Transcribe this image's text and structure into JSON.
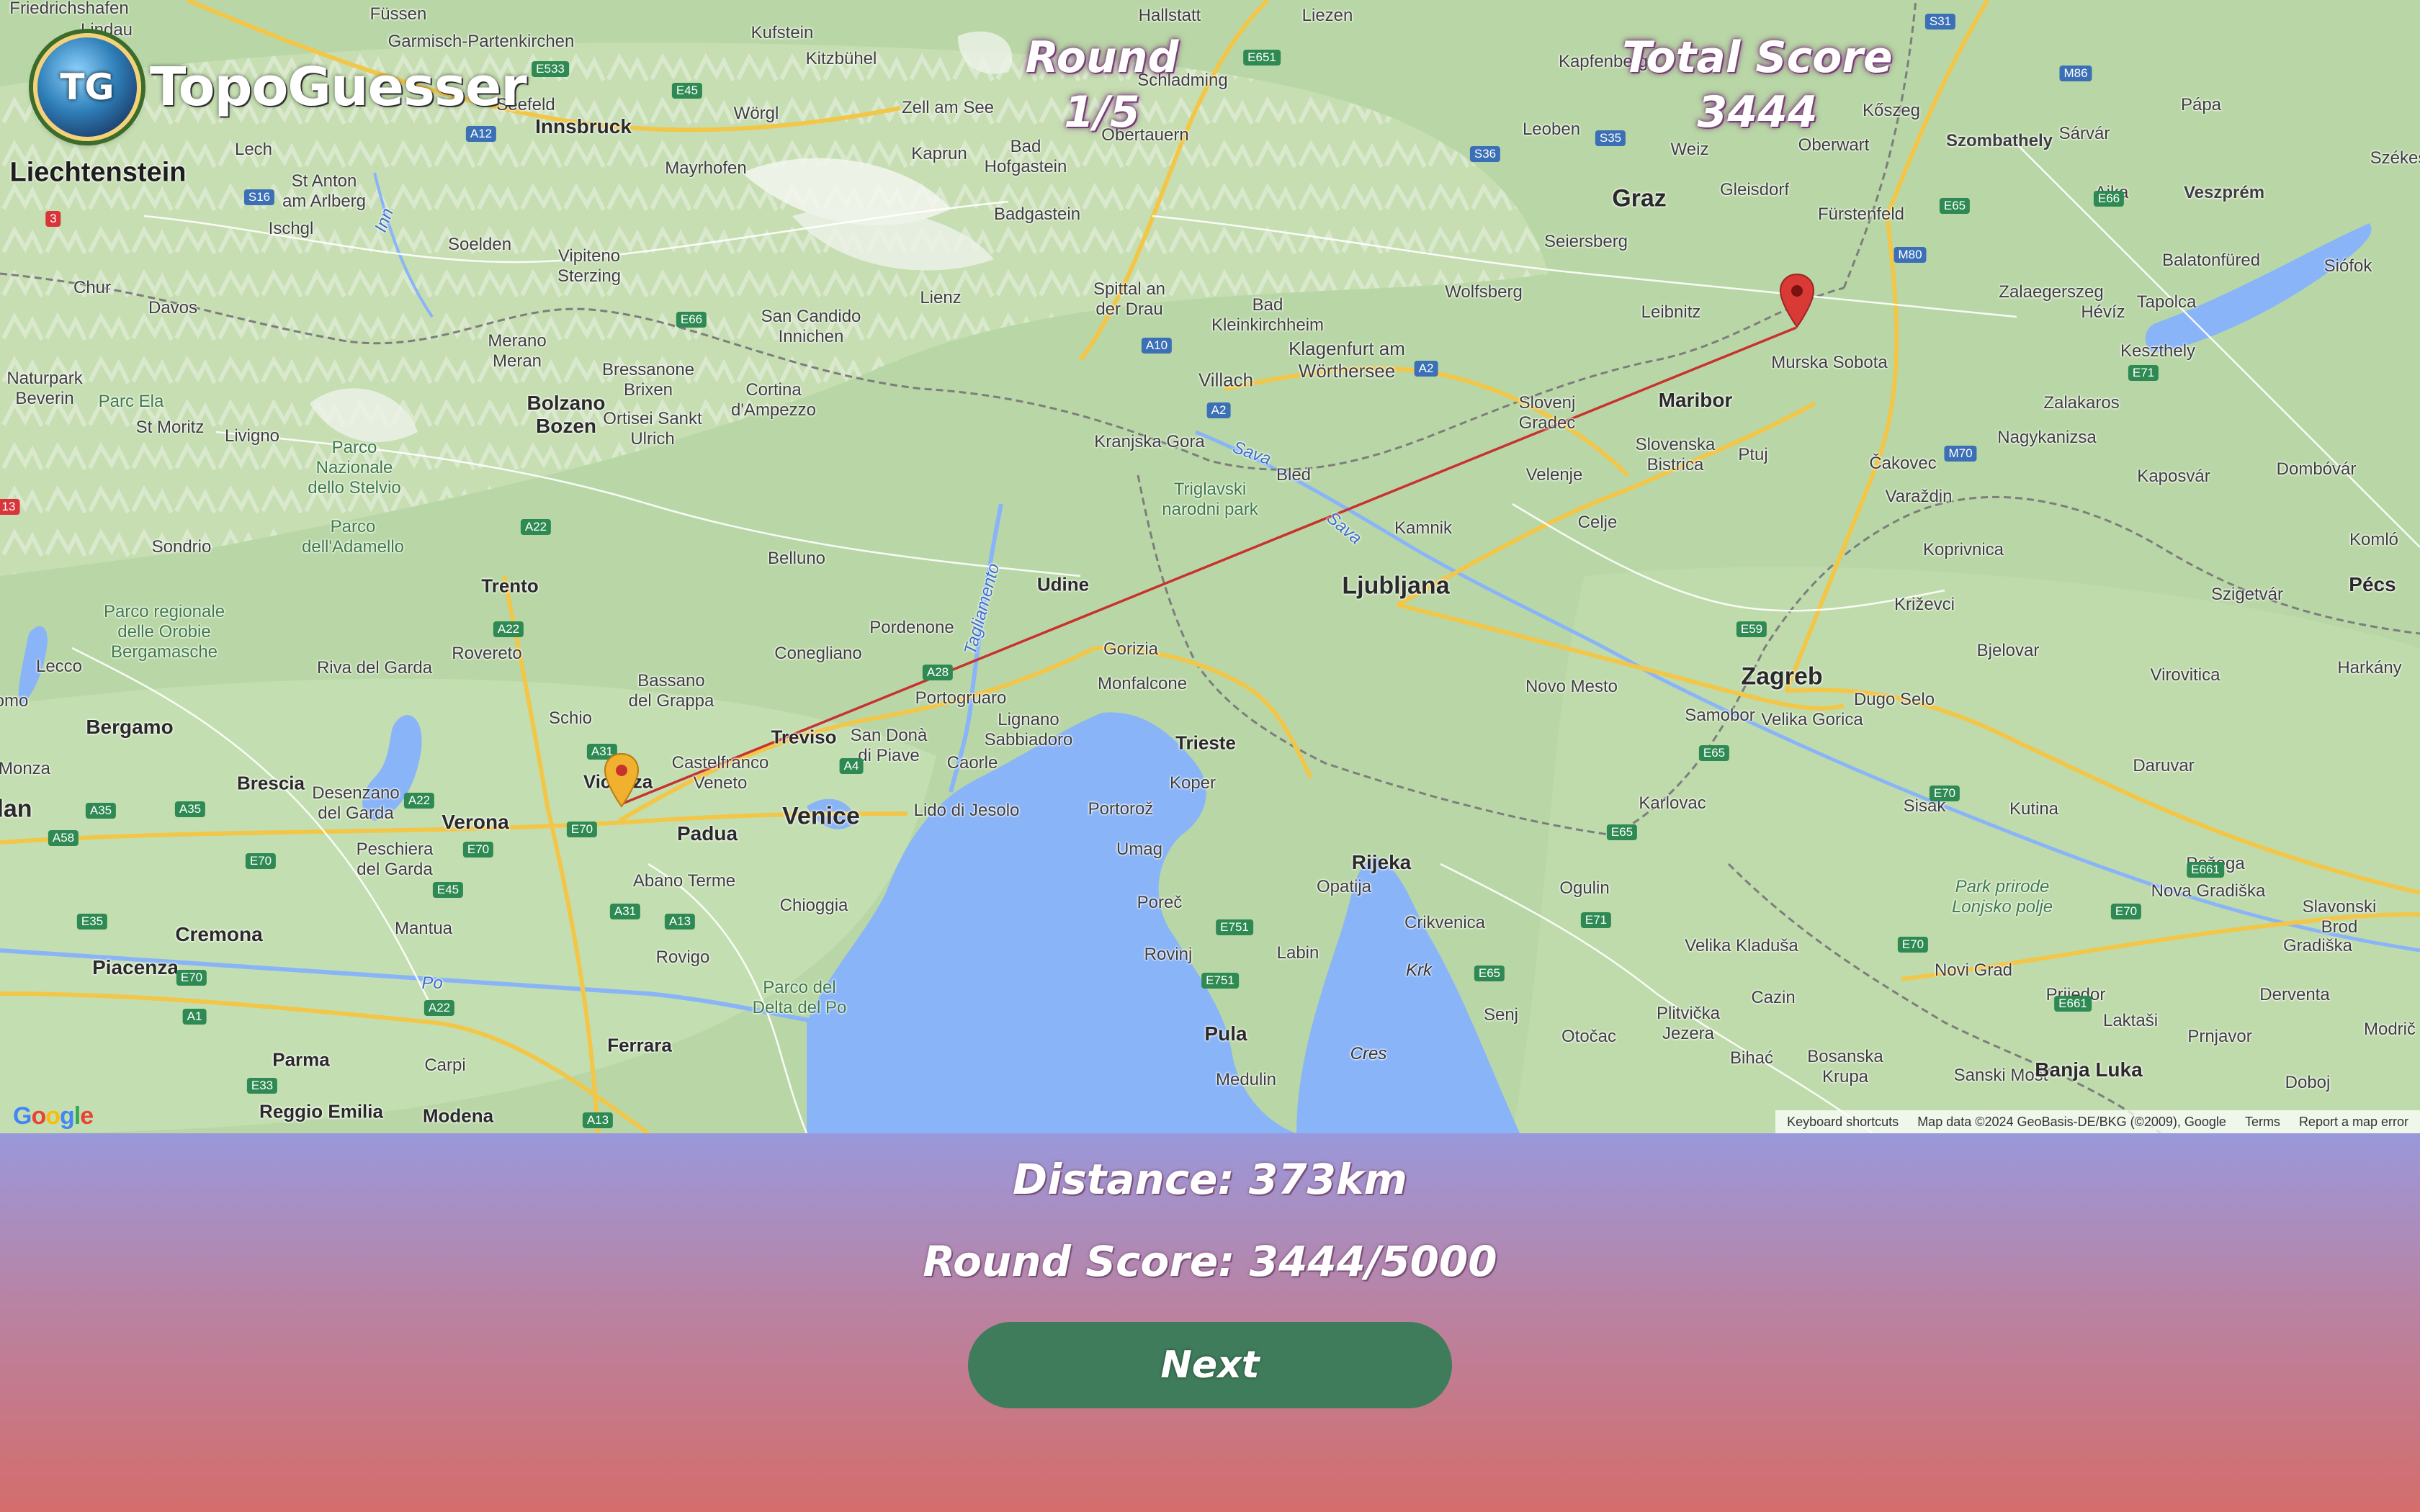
{
  "app": {
    "name": "TopoGuesser",
    "logo_initials": "TG"
  },
  "hud": {
    "round_label": "Round",
    "round_value": "1/5",
    "total_score_label": "Total Score",
    "total_score_value": "3444"
  },
  "result": {
    "distance_text": "Distance: 373km",
    "round_score_text": "Round Score: 3444/5000",
    "next_label": "Next"
  },
  "map": {
    "google_logo": "Google",
    "footer": {
      "shortcuts": "Keyboard shortcuts",
      "map_data": "Map data ©2024 GeoBasis-DE/BKG (©2009), Google",
      "terms": "Terms",
      "report": "Report a map error"
    },
    "places": {
      "friedrichshafen": "Friedrichshafen",
      "lindau": "Lindau",
      "fussen": "Füssen",
      "garmisch": "Garmisch-Partenkirchen",
      "kufstein": "Kufstein",
      "hallstatt": "Hallstatt",
      "liezen": "Liezen",
      "kapfenberg": "Kapfenberg",
      "seefeld": "Seefeld",
      "innsbruck": "Innsbruck",
      "worgl": "Wörgl",
      "kitzbuhel": "Kitzbühel",
      "schladming": "Schladming",
      "leoben": "Leoben",
      "koszeg": "Kőszeg",
      "liechtenstein": "Liechtenstein",
      "zellamsee": "Zell am See",
      "kaprun": "Kaprun",
      "badhofgastein": "Bad Hofgastein",
      "obertauern": "Obertauern",
      "weiz": "Weiz",
      "oberwart": "Oberwart",
      "szombathely": "Szombathely",
      "sarvar": "Sárvár",
      "papa": "Pápa",
      "szekes": "Székes",
      "lech": "Lech",
      "stanton": "St Anton am Arlberg",
      "mayrhofen": "Mayrhofen",
      "badgastein": "Badgastein",
      "graz": "Graz",
      "gleisdorf": "Gleisdorf",
      "furstenfeld": "Fürstenfeld",
      "ajka": "Ajka",
      "veszprem": "Veszprém",
      "ischgl": "Ischgl",
      "soelden": "Soelden",
      "vipiteno": "Vipiteno Sterzing",
      "seiersberg": "Seiersberg",
      "chur": "Chur",
      "davos": "Davos",
      "lienz": "Lienz",
      "spittal": "Spittal an der Drau",
      "badklein": "Bad Kleinkirchheim",
      "wolfsberg": "Wolfsberg",
      "leibnitz": "Leibnitz",
      "zalaegerszeg": "Zalaegerszeg",
      "balatonfured": "Balatonfüred",
      "siofok": "Siófok",
      "merano": "Merano Meran",
      "sancandido": "San Candido Innichen",
      "heviz": "Hévíz",
      "tapolca": "Tapolca",
      "keszthely": "Keszthely",
      "villach": "Villach",
      "klagenfurt": "Klagenfurt am Wörthersee",
      "murska": "Murska Sobota",
      "naturpark": "Naturpark Beverin",
      "parcela": "Parc Ela",
      "bressanone": "Bressanone Brixen",
      "cortina": "Cortina d'Ampezzo",
      "maribor": "Maribor",
      "slovenjgradec": "Slovenj Gradec",
      "zalakaros": "Zalakaros",
      "stmoritz": "St Moritz",
      "livigno": "Livigno",
      "bolzano": "Bolzano Bozen",
      "ortisei": "Ortisei Sankt Ulrich",
      "kranjska": "Kranjska Gora",
      "nagykanizsa": "Nagykanizsa",
      "stelvio": "Parco Nazionale dello Stelvio",
      "bled": "Bled",
      "slovenska": "Slovenska Bistrica",
      "ptuj": "Ptuj",
      "cakovec": "Čakovec",
      "kaposvar": "Kaposvár",
      "dombovar": "Dombóvár",
      "triglav": "Triglavski narodni park",
      "velenje": "Velenje",
      "varazdin": "Varaždin",
      "sondrio": "Sondrio",
      "adamello": "Parco dell'Adamello",
      "celje": "Celje",
      "kamnik": "Kamnik",
      "komlo": "Komló",
      "belluno": "Belluno",
      "koprivnica": "Koprivnica",
      "trento": "Trento",
      "udine": "Udine",
      "ljubljana": "Ljubljana",
      "szigetvar": "Szigetvár",
      "pecs": "Pécs",
      "orobie": "Parco regionale delle Orobie Bergamasche",
      "pordenone": "Pordenone",
      "krizevci": "Križevci",
      "rovereto": "Rovereto",
      "rivadelgarda": "Riva del Garda",
      "conegliano": "Conegliano",
      "gorizia": "Gorizia",
      "bjelovar": "Bjelovar",
      "virovitica": "Virovitica",
      "harkany": "Harkány",
      "lecco": "Lecco",
      "bassano": "Bassano del Grappa",
      "monfalcone": "Monfalcone",
      "portogruaro": "Portogruaro",
      "novomesto": "Novo Mesto",
      "zagreb": "Zagreb",
      "dugoselo": "Dugo Selo",
      "samobor": "Samobor",
      "velikagorica": "Velika Gorica",
      "como": "omo",
      "bergamo": "Bergamo",
      "schio": "Schio",
      "treviso": "Treviso",
      "lignano": "Lignano Sabbiadoro",
      "trieste": "Trieste",
      "monza": "Monza",
      "brescia": "Brescia",
      "desenzano": "Desenzano del Garda",
      "castelfranco": "Castelfranco Veneto",
      "sandona": "San Donà di Piave",
      "caorle": "Caorle",
      "koper": "Koper",
      "karlovac": "Karlovac",
      "sisak": "Sisak",
      "kutina": "Kutina",
      "daruvar": "Daruvar",
      "milan": "lan",
      "verona": "Verona",
      "vicenza": "Vicenza",
      "venice": "Venice",
      "lidodijesolo": "Lido di Jesolo",
      "portoroz": "Portorož",
      "peschiera": "Peschiera del Garda",
      "padua": "Padua",
      "umag": "Umag",
      "rijeka": "Rijeka",
      "opatija": "Opatija",
      "ogulin": "Ogulin",
      "pozega": "Požega",
      "abano": "Abano Terme",
      "chioggia": "Chioggia",
      "porec": "Poreč",
      "crikvenica": "Crikvenica",
      "lonjsko": "Park prirode Lonjsko polje",
      "novagradiska": "Nova Gradiška",
      "slavonski": "Slavonski Brod",
      "cremona": "Cremona",
      "mantua": "Mantua",
      "rovigo": "Rovigo",
      "rovinj": "Rovinj",
      "labin": "Labin",
      "krk": "Krk",
      "senj": "Senj",
      "velikakladusa": "Velika Kladuša",
      "gradiska": "Gradiška",
      "piacenza": "Piacenza",
      "po": "Po",
      "parcodelta": "Parco del Delta del Po",
      "cazin": "Cazin",
      "novigrad": "Novi Grad",
      "prijedor": "Prijedor",
      "derventa": "Derventa",
      "pula": "Pula",
      "otocac": "Otočac",
      "laktasi": "Laktaši",
      "prnjavor": "Prnjavor",
      "parma": "Parma",
      "carpi": "Carpi",
      "ferrara": "Ferrara",
      "cres": "Cres",
      "plitvicka": "Plitvička Jezera",
      "bihac": "Bihać",
      "bosanska": "Bosanska Krupa",
      "sanskimost": "Sanski Most",
      "banjaluka": "Banja Luka",
      "doboj": "Doboj",
      "reggio": "Reggio Emilia",
      "modena": "Modena",
      "medulin": "Medulin",
      "modrica": "Modrič",
      "inn": "Inn",
      "sava1": "Sava",
      "sava2": "Sava",
      "tagliamento": "Tagliamento"
    },
    "roads": {
      "e533": "E533",
      "e45a": "E45",
      "a12": "A12",
      "s16": "S16",
      "r3": "3",
      "e651": "E651",
      "s36": "S36",
      "s35": "S35",
      "s31": "S31",
      "m86": "M86",
      "e66a": "E66",
      "e65a": "E65",
      "e66b": "E66",
      "m80": "M80",
      "a10": "A10",
      "a2a": "A2",
      "a2b": "A2",
      "e71a": "E71",
      "m70": "M70",
      "r13": "13",
      "a22a": "A22",
      "a22b": "A22",
      "e59": "E59",
      "a28": "A28",
      "a31a": "A31",
      "e70a": "E70",
      "a35": "A35",
      "a35b": "A35",
      "a58": "A58",
      "a22c": "A22",
      "e70b": "E70",
      "e70c": "E70",
      "e45b": "E45",
      "a4": "A4",
      "a31b": "A31",
      "a13": "A13",
      "e65b": "E65",
      "e70d": "E70",
      "e65c": "E65",
      "e661": "E661",
      "e70e": "E70",
      "e751": "E751",
      "a35c": "E35",
      "e70f": "E70",
      "a1": "A1",
      "a22d": "A22",
      "e751b": "E751",
      "e65d": "E65",
      "e71b": "E71",
      "e661b": "E661",
      "e33": "E33",
      "a13b": "A13",
      "e70g": "E70"
    }
  },
  "colors": {
    "map_land": "#b9d7a6",
    "map_water": "#8ab4f8",
    "guess_marker": "#f2b02f",
    "answer_marker": "#d93a36",
    "line": "#c8322e",
    "next_button": "#3f7c5b",
    "panel_top": "#9a98db",
    "panel_bottom": "#d46d6b",
    "hud_shadow": "#7b3d7a"
  }
}
